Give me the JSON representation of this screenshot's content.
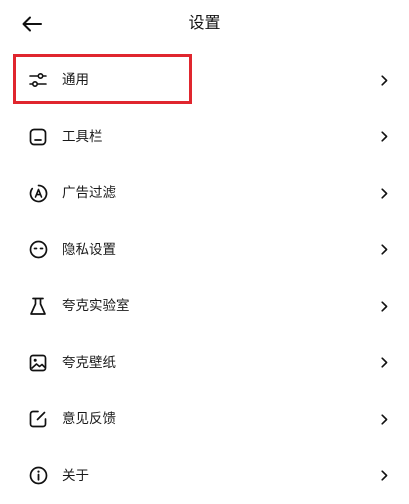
{
  "header": {
    "title": "设置",
    "back_icon": "arrow-left-icon"
  },
  "accent_highlight_color": "#e0262e",
  "menu": [
    {
      "label": "通用",
      "icon": "sliders-icon",
      "highlighted": true
    },
    {
      "label": "工具栏",
      "icon": "toolbar-icon"
    },
    {
      "label": "广告过滤",
      "icon": "ad-filter-icon"
    },
    {
      "label": "隐私设置",
      "icon": "privacy-icon"
    },
    {
      "label": "夸克实验室",
      "icon": "flask-icon"
    },
    {
      "label": "夸克壁纸",
      "icon": "image-icon"
    },
    {
      "label": "意见反馈",
      "icon": "feedback-icon"
    },
    {
      "label": "关于",
      "icon": "info-icon"
    }
  ]
}
